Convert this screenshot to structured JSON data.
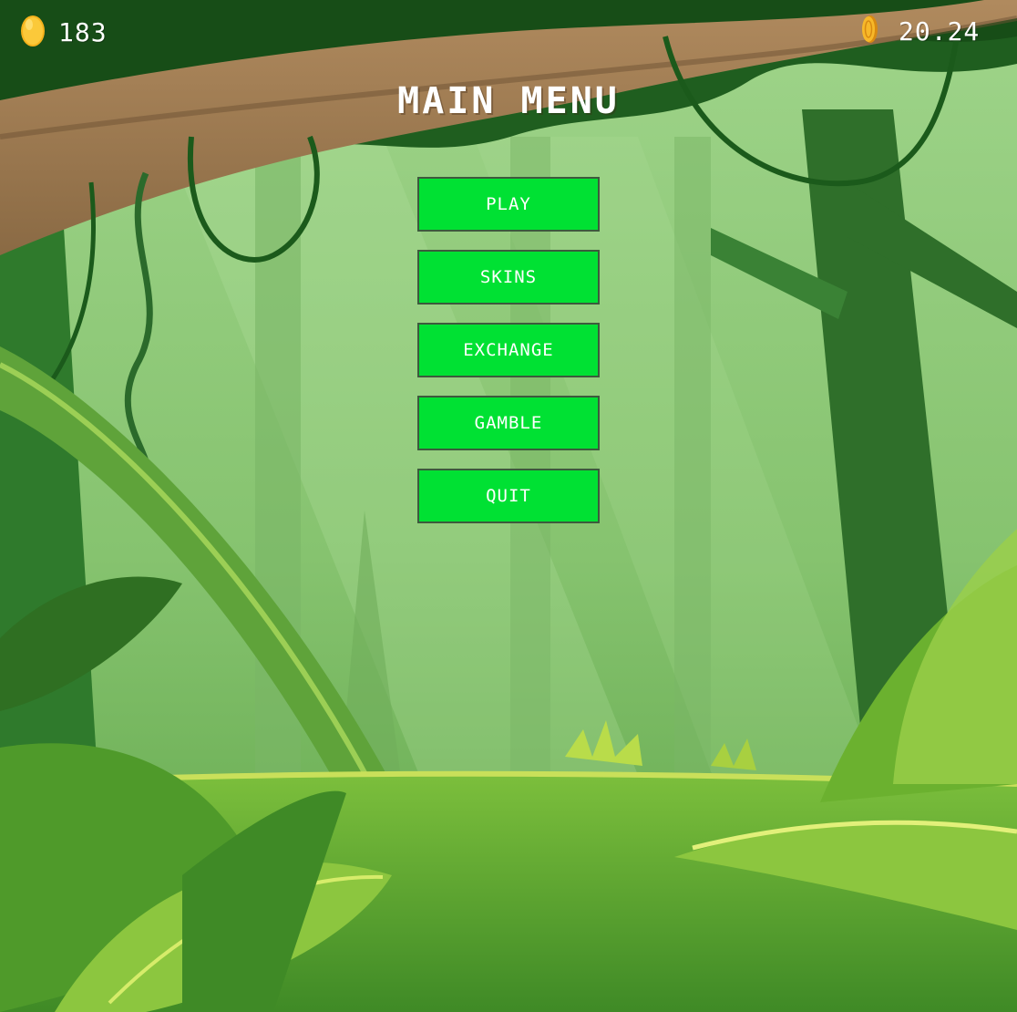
{
  "hud": {
    "eggs": {
      "icon": "golden-egg-icon",
      "value": "183"
    },
    "coins": {
      "icon": "gold-coin-icon",
      "value": "20.24"
    }
  },
  "title": "MAIN MENU",
  "menu": {
    "items": [
      "PLAY",
      "SKINS",
      "EXCHANGE",
      "GAMBLE",
      "QUIT"
    ]
  },
  "colors": {
    "button": "#00e133",
    "button_border": "#3d5a3d",
    "text": "#ffffff"
  }
}
